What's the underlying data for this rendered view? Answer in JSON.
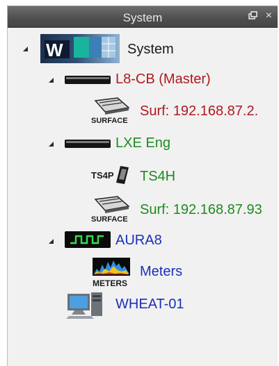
{
  "panel": {
    "title": "System",
    "pin_icon": "pin-icon",
    "close_glyph": "×"
  },
  "tree": {
    "root": {
      "label": "System",
      "icon": "w-logo-icon",
      "color": "#1a1a1a"
    },
    "l8cb": {
      "label": "L8-CB (Master)",
      "icon": "device-bar-icon",
      "color": "#b0191e"
    },
    "l8cb_surf": {
      "label": "Surf: 192.168.87.2.",
      "icon": "surface-icon",
      "icon_text": "SURFACE",
      "color": "#b0191e"
    },
    "lxe": {
      "label": "LXE Eng",
      "icon": "device-bar-icon",
      "color": "#1f8a1f"
    },
    "ts4h": {
      "label": "TS4H",
      "icon": "ts4p-icon",
      "icon_text": "TS4P",
      "color": "#1f8a1f"
    },
    "lxe_surf": {
      "label": "Surf: 192.168.87.93",
      "icon": "surface-icon",
      "icon_text": "SURFACE",
      "color": "#1f8a1f"
    },
    "aura8": {
      "label": "AURA8",
      "icon": "waveform-icon",
      "color": "#1c2fb8"
    },
    "meters": {
      "label": "Meters",
      "icon": "meters-icon",
      "icon_text": "METERS",
      "color": "#1c2fb8"
    },
    "wheat01": {
      "label": "WHEAT-01",
      "icon": "computer-icon",
      "color": "#1c2fb8"
    }
  }
}
